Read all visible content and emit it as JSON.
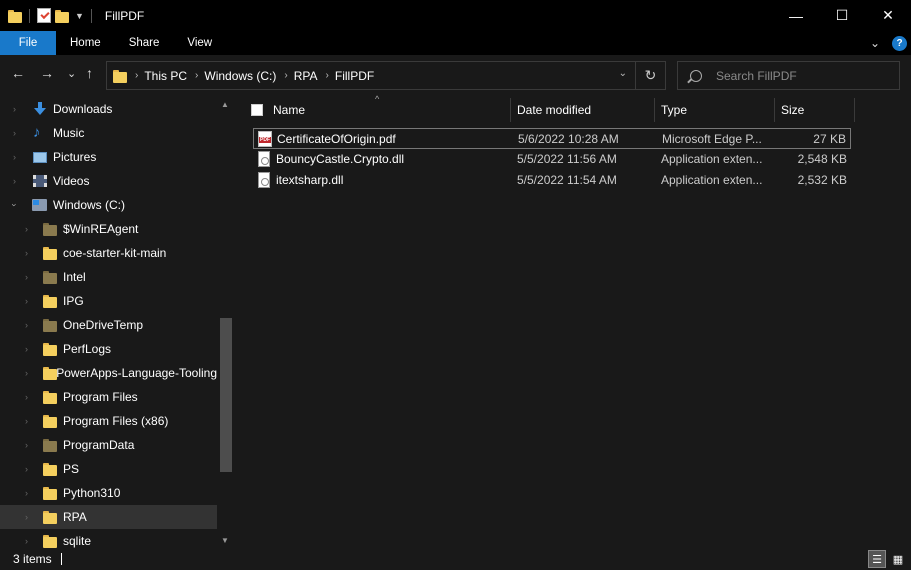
{
  "window": {
    "title": "FillPDF",
    "minimize": "—",
    "maximize": "☐",
    "close": "✕"
  },
  "ribbon": {
    "tabs": [
      "File",
      "Home",
      "Share",
      "View"
    ],
    "expand": "⌄",
    "help": "?"
  },
  "nav": {
    "back": "←",
    "forward": "→",
    "recent": "⌄",
    "up": "↑"
  },
  "address": {
    "crumbs": [
      "This PC",
      "Windows (C:)",
      "RPA",
      "FillPDF"
    ],
    "separator": "›",
    "dropdown": "⌄",
    "refresh": "↻"
  },
  "search": {
    "placeholder": "Search FillPDF"
  },
  "sidebar": {
    "items": [
      {
        "label": "Downloads",
        "icon": "download-icon"
      },
      {
        "label": "Music",
        "icon": "music-icon"
      },
      {
        "label": "Pictures",
        "icon": "pictures-icon"
      },
      {
        "label": "Videos",
        "icon": "videos-icon"
      },
      {
        "label": "Windows (C:)",
        "icon": "drive-icon"
      },
      {
        "label": "$WinREAgent",
        "icon": "folder-icon"
      },
      {
        "label": "coe-starter-kit-main",
        "icon": "folder-icon"
      },
      {
        "label": "Intel",
        "icon": "folder-icon"
      },
      {
        "label": "IPG",
        "icon": "folder-icon"
      },
      {
        "label": "OneDriveTemp",
        "icon": "folder-icon"
      },
      {
        "label": "PerfLogs",
        "icon": "folder-icon"
      },
      {
        "label": "PowerApps-Language-Tooling",
        "icon": "folder-icon"
      },
      {
        "label": "Program Files",
        "icon": "folder-icon"
      },
      {
        "label": "Program Files (x86)",
        "icon": "folder-icon"
      },
      {
        "label": "ProgramData",
        "icon": "folder-icon"
      },
      {
        "label": "PS",
        "icon": "folder-icon"
      },
      {
        "label": "Python310",
        "icon": "folder-icon"
      },
      {
        "label": "RPA",
        "icon": "folder-icon"
      },
      {
        "label": "sqlite",
        "icon": "folder-icon"
      }
    ],
    "selected": "RPA"
  },
  "columns": {
    "name": "Name",
    "date": "Date modified",
    "type": "Type",
    "size": "Size",
    "sort_indicator": "^"
  },
  "files": [
    {
      "name": "CertificateOfOrigin.pdf",
      "date": "5/6/2022 10:28 AM",
      "type": "Microsoft Edge P...",
      "size": "27 KB",
      "icon": "pdf-icon"
    },
    {
      "name": "BouncyCastle.Crypto.dll",
      "date": "5/5/2022 11:56 AM",
      "type": "Application exten...",
      "size": "2,548 KB",
      "icon": "dll-icon"
    },
    {
      "name": "itextsharp.dll",
      "date": "5/5/2022 11:54 AM",
      "type": "Application exten...",
      "size": "2,532 KB",
      "icon": "dll-icon"
    }
  ],
  "status": {
    "count": "3 items"
  },
  "colors": {
    "accent": "#1979ca",
    "background": "#191919",
    "titlebar": "#000000",
    "folder": "#f4cf5e"
  }
}
